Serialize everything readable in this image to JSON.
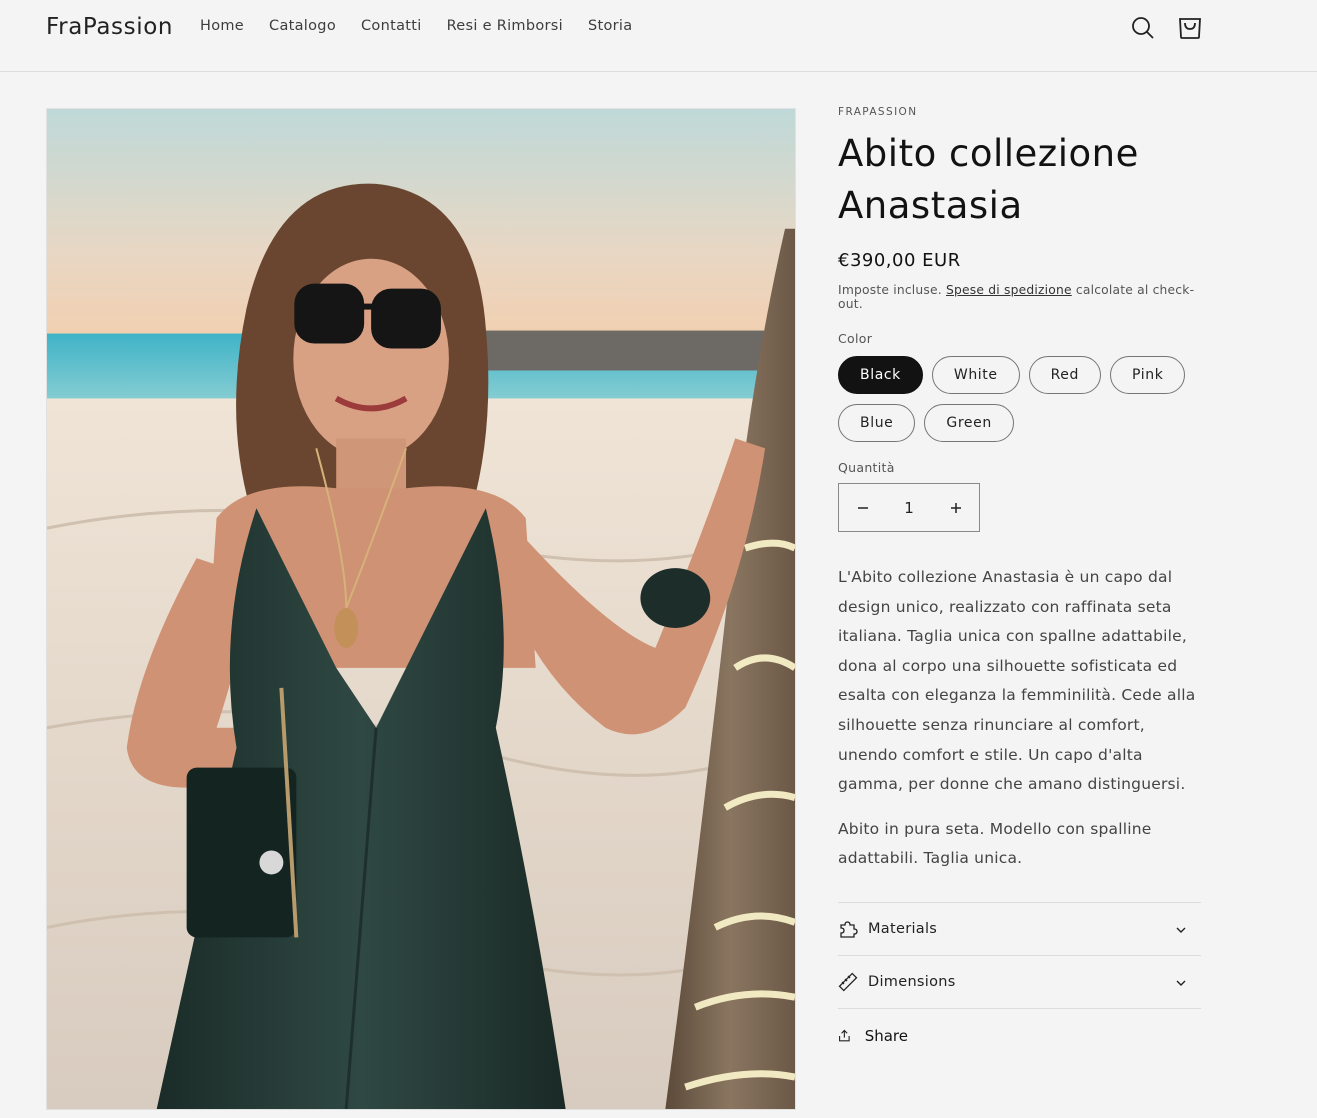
{
  "header": {
    "logo": "FraPassion",
    "nav": [
      "Home",
      "Catalogo",
      "Contatti",
      "Resi e Rimborsi",
      "Storia"
    ]
  },
  "product": {
    "vendor": "FRAPASSION",
    "title_line1": "Abito collezione",
    "title_line2": "Anastasia",
    "price": "€390,00 EUR",
    "tax_prefix": "Imposte incluse.",
    "tax_link": "Spese di spedizione",
    "tax_suffix": "calcolate al check-out.",
    "color_label": "Color",
    "colors": [
      "Black",
      "White",
      "Red",
      "Pink",
      "Blue",
      "Green"
    ],
    "selected_color": "Black",
    "quantity_label": "Quantità",
    "quantity": "1",
    "description": "L'Abito collezione Anastasia è un capo dal design unico, realizzato con raffinata seta italiana. Taglia unica con spallne adattabile, dona al corpo una silhouette sofisticata ed esalta con eleganza la femminilità. Cede alla silhouette senza rinunciare al comfort, unendo comfort e stile. Un capo d'alta gamma, per donne che amano distinguersi.",
    "description2": "Abito in pura seta. Modello con spalline adattabili. Taglia unica.",
    "accordion": [
      "Materials",
      "Dimensions"
    ],
    "share": "Share"
  },
  "icons": {
    "search": "search-icon",
    "cart": "cart-icon",
    "minus": "minus-icon",
    "plus": "plus-icon",
    "materials": "puzzle-icon",
    "dimensions": "ruler-icon",
    "chevron": "chevron-down-icon",
    "share": "share-icon"
  },
  "colors": {
    "background": "#f4f4f4",
    "text": "#121212",
    "selected_swatch": "#121212"
  }
}
